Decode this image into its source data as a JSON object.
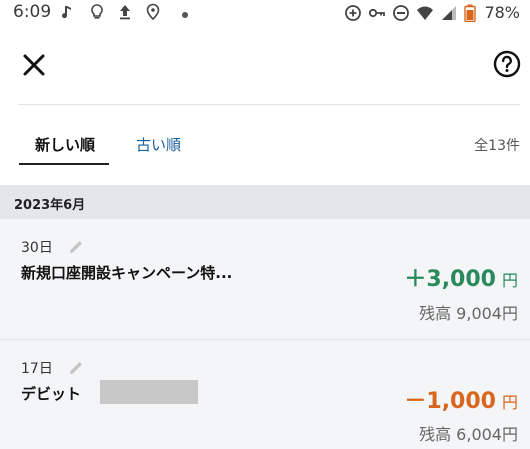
{
  "status_bar": {
    "time": "6:09",
    "battery_percent": "78%",
    "icons_left": [
      "music-note-icon",
      "lightbulb-icon",
      "upload-icon",
      "location-icon",
      "dot-icon"
    ],
    "icons_right": [
      "sync-plus-icon",
      "key-icon",
      "do-not-disturb-icon",
      "wifi-icon",
      "signal-icon",
      "battery-icon"
    ]
  },
  "topbar": {
    "close_icon": "close-icon",
    "help_icon": "help-icon"
  },
  "tabs": {
    "newest": "新しい順",
    "oldest": "古い順",
    "total": "全13件"
  },
  "month": "2023年6月",
  "transactions": [
    {
      "date": "30日",
      "description": "新規口座開設キャンペーン特...",
      "amount": "＋3,000",
      "currency": "円",
      "balance": "残高 9,004円",
      "type": "credit",
      "color": "#2a8a5c"
    },
    {
      "date": "17日",
      "description": "デビット",
      "amount": "－1,000",
      "currency": "円",
      "balance": "残高 6,004円",
      "type": "debit",
      "color": "#d9661d"
    }
  ],
  "colors": {
    "accent_link": "#1b5e9e",
    "credit": "#2a8a5c",
    "debit": "#d9661d",
    "month_bg": "#e4e6ea"
  }
}
